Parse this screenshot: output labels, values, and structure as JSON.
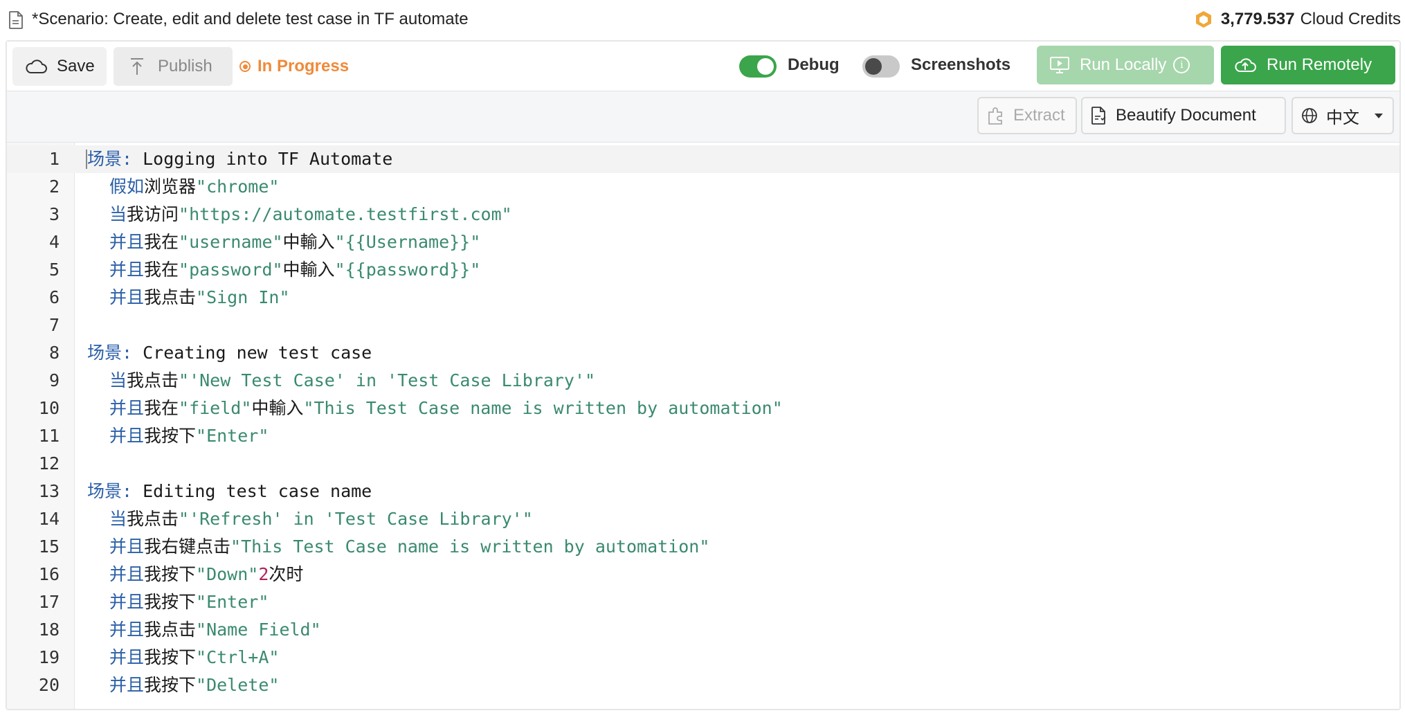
{
  "header": {
    "title": "*Scenario: Create, edit and delete test case in TF automate",
    "credits_value": "3,779.537",
    "credits_label": "Cloud Credits",
    "coin_color": "#f0a73a"
  },
  "toolbar": {
    "save_label": "Save",
    "publish_label": "Publish",
    "status_label": "In Progress",
    "debug_label": "Debug",
    "debug_on": true,
    "screenshots_label": "Screenshots",
    "screenshots_on": false,
    "run_locally_label": "Run Locally",
    "run_remotely_label": "Run Remotely",
    "accent_color": "#3aa54a",
    "status_color": "#ef8a3a"
  },
  "subbar": {
    "extract_label": "Extract",
    "beautify_label": "Beautify Document",
    "language_label": "中文"
  },
  "editor": {
    "lines": [
      {
        "n": "1",
        "segs": [
          [
            "kw",
            "场景: "
          ],
          [
            "tx",
            "Logging into TF Automate"
          ]
        ],
        "indent": false
      },
      {
        "n": "2",
        "segs": [
          [
            "kw",
            "假如"
          ],
          [
            "tx",
            "浏览器"
          ],
          [
            "st",
            "\"chrome\""
          ]
        ],
        "indent": true
      },
      {
        "n": "3",
        "segs": [
          [
            "kw",
            "当"
          ],
          [
            "tx",
            "我访问"
          ],
          [
            "st",
            "\"https://automate.testfirst.com\""
          ]
        ],
        "indent": true
      },
      {
        "n": "4",
        "segs": [
          [
            "kw",
            "并且"
          ],
          [
            "tx",
            "我在"
          ],
          [
            "st",
            "\"username\""
          ],
          [
            "tx",
            "中輸入"
          ],
          [
            "st",
            "\"{{Username}}\""
          ]
        ],
        "indent": true
      },
      {
        "n": "5",
        "segs": [
          [
            "kw",
            "并且"
          ],
          [
            "tx",
            "我在"
          ],
          [
            "st",
            "\"password\""
          ],
          [
            "tx",
            "中輸入"
          ],
          [
            "st",
            "\"{{password}}\""
          ]
        ],
        "indent": true
      },
      {
        "n": "6",
        "segs": [
          [
            "kw",
            "并且"
          ],
          [
            "tx",
            "我点击"
          ],
          [
            "st",
            "\"Sign In\""
          ]
        ],
        "indent": true
      },
      {
        "n": "7",
        "segs": [],
        "indent": false
      },
      {
        "n": "8",
        "segs": [
          [
            "kw",
            "场景: "
          ],
          [
            "tx",
            "Creating new test case"
          ]
        ],
        "indent": false
      },
      {
        "n": "9",
        "segs": [
          [
            "kw",
            "当"
          ],
          [
            "tx",
            "我点击"
          ],
          [
            "st",
            "\"'New Test Case' in 'Test Case Library'\""
          ]
        ],
        "indent": true
      },
      {
        "n": "10",
        "segs": [
          [
            "kw",
            "并且"
          ],
          [
            "tx",
            "我在"
          ],
          [
            "st",
            "\"field\""
          ],
          [
            "tx",
            "中輸入"
          ],
          [
            "st",
            "\"This Test Case name is written by automation\""
          ]
        ],
        "indent": true
      },
      {
        "n": "11",
        "segs": [
          [
            "kw",
            "并且"
          ],
          [
            "tx",
            "我按下"
          ],
          [
            "st",
            "\"Enter\""
          ]
        ],
        "indent": true
      },
      {
        "n": "12",
        "segs": [],
        "indent": false
      },
      {
        "n": "13",
        "segs": [
          [
            "kw",
            "场景: "
          ],
          [
            "tx",
            "Editing test case name"
          ]
        ],
        "indent": false
      },
      {
        "n": "14",
        "segs": [
          [
            "kw",
            "当"
          ],
          [
            "tx",
            "我点击"
          ],
          [
            "st",
            "\"'Refresh' in 'Test Case Library'\""
          ]
        ],
        "indent": true
      },
      {
        "n": "15",
        "segs": [
          [
            "kw",
            "并且"
          ],
          [
            "tx",
            "我右键点击"
          ],
          [
            "st",
            "\"This Test Case name is written by automation\""
          ]
        ],
        "indent": true
      },
      {
        "n": "16",
        "segs": [
          [
            "kw",
            "并且"
          ],
          [
            "tx",
            "我按下"
          ],
          [
            "st",
            "\"Down\""
          ],
          [
            "nm",
            "2"
          ],
          [
            "tx",
            "次时"
          ]
        ],
        "indent": true
      },
      {
        "n": "17",
        "segs": [
          [
            "kw",
            "并且"
          ],
          [
            "tx",
            "我按下"
          ],
          [
            "st",
            "\"Enter\""
          ]
        ],
        "indent": true
      },
      {
        "n": "18",
        "segs": [
          [
            "kw",
            "并且"
          ],
          [
            "tx",
            "我点击"
          ],
          [
            "st",
            "\"Name Field\""
          ]
        ],
        "indent": true
      },
      {
        "n": "19",
        "segs": [
          [
            "kw",
            "并且"
          ],
          [
            "tx",
            "我按下"
          ],
          [
            "st",
            "\"Ctrl+A\""
          ]
        ],
        "indent": true
      },
      {
        "n": "20",
        "segs": [
          [
            "kw",
            "并且"
          ],
          [
            "tx",
            "我按下"
          ],
          [
            "st",
            "\"Delete\""
          ]
        ],
        "indent": true
      }
    ]
  }
}
